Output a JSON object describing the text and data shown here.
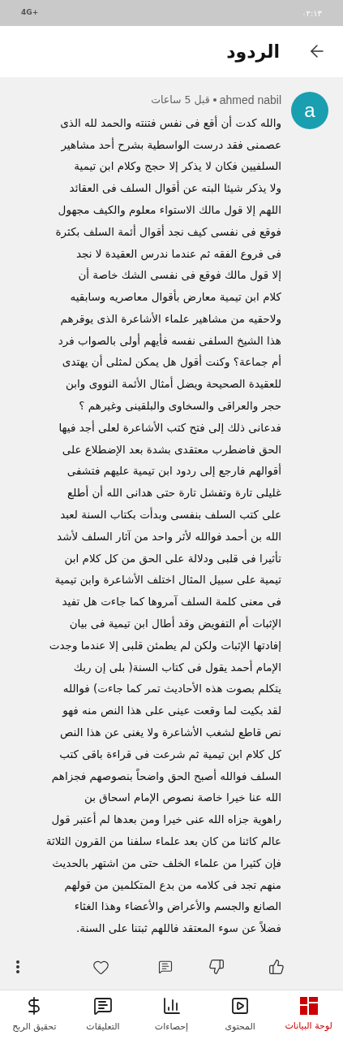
{
  "status_bar": {
    "time": "٠٢:١٣",
    "network": "4G+"
  },
  "header": {
    "title": "الردود"
  },
  "comment": {
    "avatar": "a",
    "author": "ahmed nabil",
    "time": "قبل 5 ساعات",
    "body": "والله كدت أن أقع فى نفس فتنته والحمد لله الذى\nعصمنى فقد درست الواسطية بشرح أحد مشاهير\nالسلفيين فكان لا يذكر إلا حجج وكلام ابن تيمية\nولا يذكر شيئا البته عن أقوال السلف فى العقائد\nاللهم إلا قول مالك الاستواء معلوم والكيف مجهول\nفوقع فى نفسى كيف نجد أقوال أئمة السلف بكثرة\nفى فروع الفقه ثم عندما ندرس العقيدة لا نجد\nإلا قول مالك فوقع فى نفسى الشك خاصة أن\nكلام ابن تيمية معارض بأقوال معاصريه وسابقيه\nولاحقيه من مشاهير علماء الأشاعرة الذى يوقرهم\nهذا الشيخ السلفى نفسه فأيهم أولى بالصواب فرد\nأم جماعة؟ وكنت أقول هل يمكن لمثلى أن يهتدى\nللعقيدة الصحيحة ويضل أمثال الأئمة النووى وابن\nحجر والعراقى والسخاوى والبلقينى وغيرهم ؟\nفدعانى ذلك إلى فتح كتب الأشاعرة لعلى أجد فيها\nالحق فاضطرب معتقدى بشدة بعد الإضطلاع على\nأقوالهم فارجع إلى ردود ابن تيمية عليهم فتشفى\nغليلى تارة وتفشل تارة حتى هدانى الله أن أطلع\nعلى كتب السلف بنفسى وبدأت بكتاب السنة لعبد\nالله بن أحمد فوالله لأثر واحد من آثار السلف لأشد\nتأثيرا فى قلبى ودلالة على الحق من كل كلام ابن\nتيمية على سبيل المثال اختلف الأشاعرة وابن تيمية\nفى معنى كلمة السلف آمروها كما جاءت هل تفيد\nالإثبات أم التفويض وقد أطال ابن تيمية فى بيان\nإفادتها الإثبات ولكن لم يطمئن قلبى إلا عندما وجدت\nالإمام أحمد يقول فى كتاب السنة( بلى إن ربك\nيتكلم بصوت هذه الأحاديث تمر كما جاءت) فوالله\nلقد بكيت لما وقعت عينى على هذا النص منه فهو\nنص قاطع لشغب الأشاعرة ولا يغنى عن هذا النص\nكل كلام ابن تيمية ثم شرعت فى قراءة باقى كتب\nالسلف فوالله أصبح الحق واضحاً بنصوصهم فجزاهم\nالله عنا خيرا خاصة نصوص الإمام اسحاق بن\nراهوية جزاه الله عنى خيرا ومن بعدها لم أعتبر قول\nعالم كائنا من كان بعد علماء سلفنا من القرون الثلاثة\nفإن كثيرا من علماء الخلف حتى من اشتهر بالحديث\nمنهم تجد فى كلامه من بدع المتكلمين من قولهم\nالصانع والجسم والأعراض والأعضاء وهذا الغثاء\nفضلاً عن سوء المعتقد فاللهم ثبتنا على السنة."
  },
  "nav": [
    {
      "kind": "dashboard",
      "label": "لوحة البيانات",
      "selected": true
    },
    {
      "kind": "content",
      "label": "المحتوى",
      "selected": false
    },
    {
      "kind": "analytics",
      "label": "إحصاءات",
      "selected": false
    },
    {
      "kind": "comments",
      "label": "التعليقات",
      "selected": false
    },
    {
      "kind": "earn",
      "label": "تحقيق الربح",
      "selected": false
    }
  ]
}
